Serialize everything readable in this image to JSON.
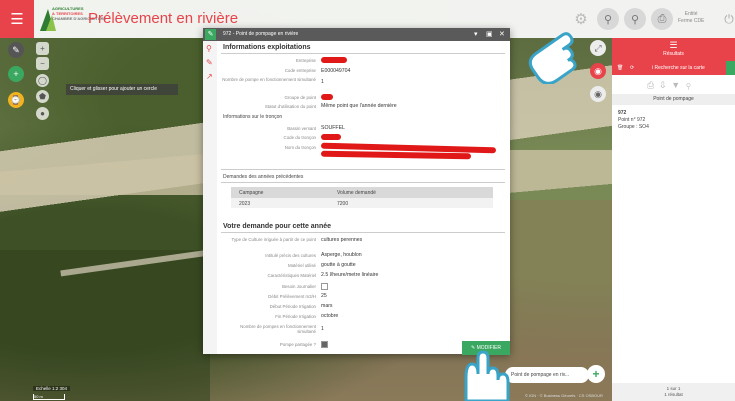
{
  "app": {
    "title": "Prélèvement en rivière",
    "logo_text": [
      "AGRICULTURES",
      "& TERRITOIRES",
      "CHAMBRE D'AGRICULTURE"
    ],
    "user_label": [
      "Entité",
      "Ferme CDE"
    ]
  },
  "map": {
    "hint": "Cliquer et glisser pour ajouter un cercle",
    "scale": "Echelle 1:2 304",
    "scale_sub": "50 m",
    "attribution": "© IGN · © Business Géorefs · CS OSBOUR"
  },
  "modal": {
    "title": "972 - Point de pompage en rivière",
    "sections": {
      "info": "Informations exploitations",
      "troncon": "Informations sur le tronçon",
      "previous": "Demandes des années précédentes",
      "current": "Votre demande pour cette année"
    },
    "info_rows": [
      {
        "label": "Entreprise",
        "value": "",
        "redacted": true
      },
      {
        "label": "Code entreprise",
        "value": "E000049704"
      },
      {
        "label": "Nombre de pompe en fonctionnement simultané",
        "value": "1"
      },
      {
        "label": "Groupe de point",
        "value": "",
        "redacted": true
      },
      {
        "label": "Statut d'utilisation du point",
        "value": "Même point que l'année dernière"
      }
    ],
    "troncon_rows": [
      {
        "label": "Bassin versant",
        "value": "SOUFFEL"
      },
      {
        "label": "Code du tronçon",
        "value": "",
        "redacted": true
      },
      {
        "label": "Nom du tronçon",
        "value": "",
        "redacted": true
      }
    ],
    "table": {
      "headers": [
        "Campagne",
        "Volume demandé"
      ],
      "rows": [
        [
          "2023",
          "7200"
        ]
      ]
    },
    "current_rows": [
      {
        "label": "Type de Culture irriguée à partir de ce point",
        "value": "cultures perennes"
      },
      {
        "label": "Intitulé précis des cultures",
        "value": "Asperge, houblon"
      },
      {
        "label": "Matériel utilisé",
        "value": "goutte à goutte"
      },
      {
        "label": "Caractéristiques Matériel",
        "value": "2.5 l/heure/metre linéaire"
      },
      {
        "label": "Besoin Journalier",
        "value": "",
        "checkbox": false
      },
      {
        "label": "Débit Prélèvement m3/H",
        "value": "25"
      },
      {
        "label": "Début Période Irrigation",
        "value": "mars"
      },
      {
        "label": "Fin Période Irrigation",
        "value": "octobre"
      },
      {
        "label": "Nombre de pompes en fonctionnement simultané",
        "value": "1"
      },
      {
        "label": "Pompe partagée ?",
        "value": "",
        "checkbox": true
      }
    ],
    "modify_label": "MODIFIER"
  },
  "right_panel": {
    "header": "Résultats",
    "search_label": "Recherche sur la carte",
    "column_header": "Point de pompage",
    "item": [
      "972",
      "Point n° 972",
      "Groupe : SO4"
    ],
    "footer": [
      "1 sur 1",
      "1 résultat"
    ]
  },
  "bottom_chip": "Point de pompage en riv...",
  "colors": {
    "accent": "#e8434a",
    "green": "#3aa860"
  }
}
